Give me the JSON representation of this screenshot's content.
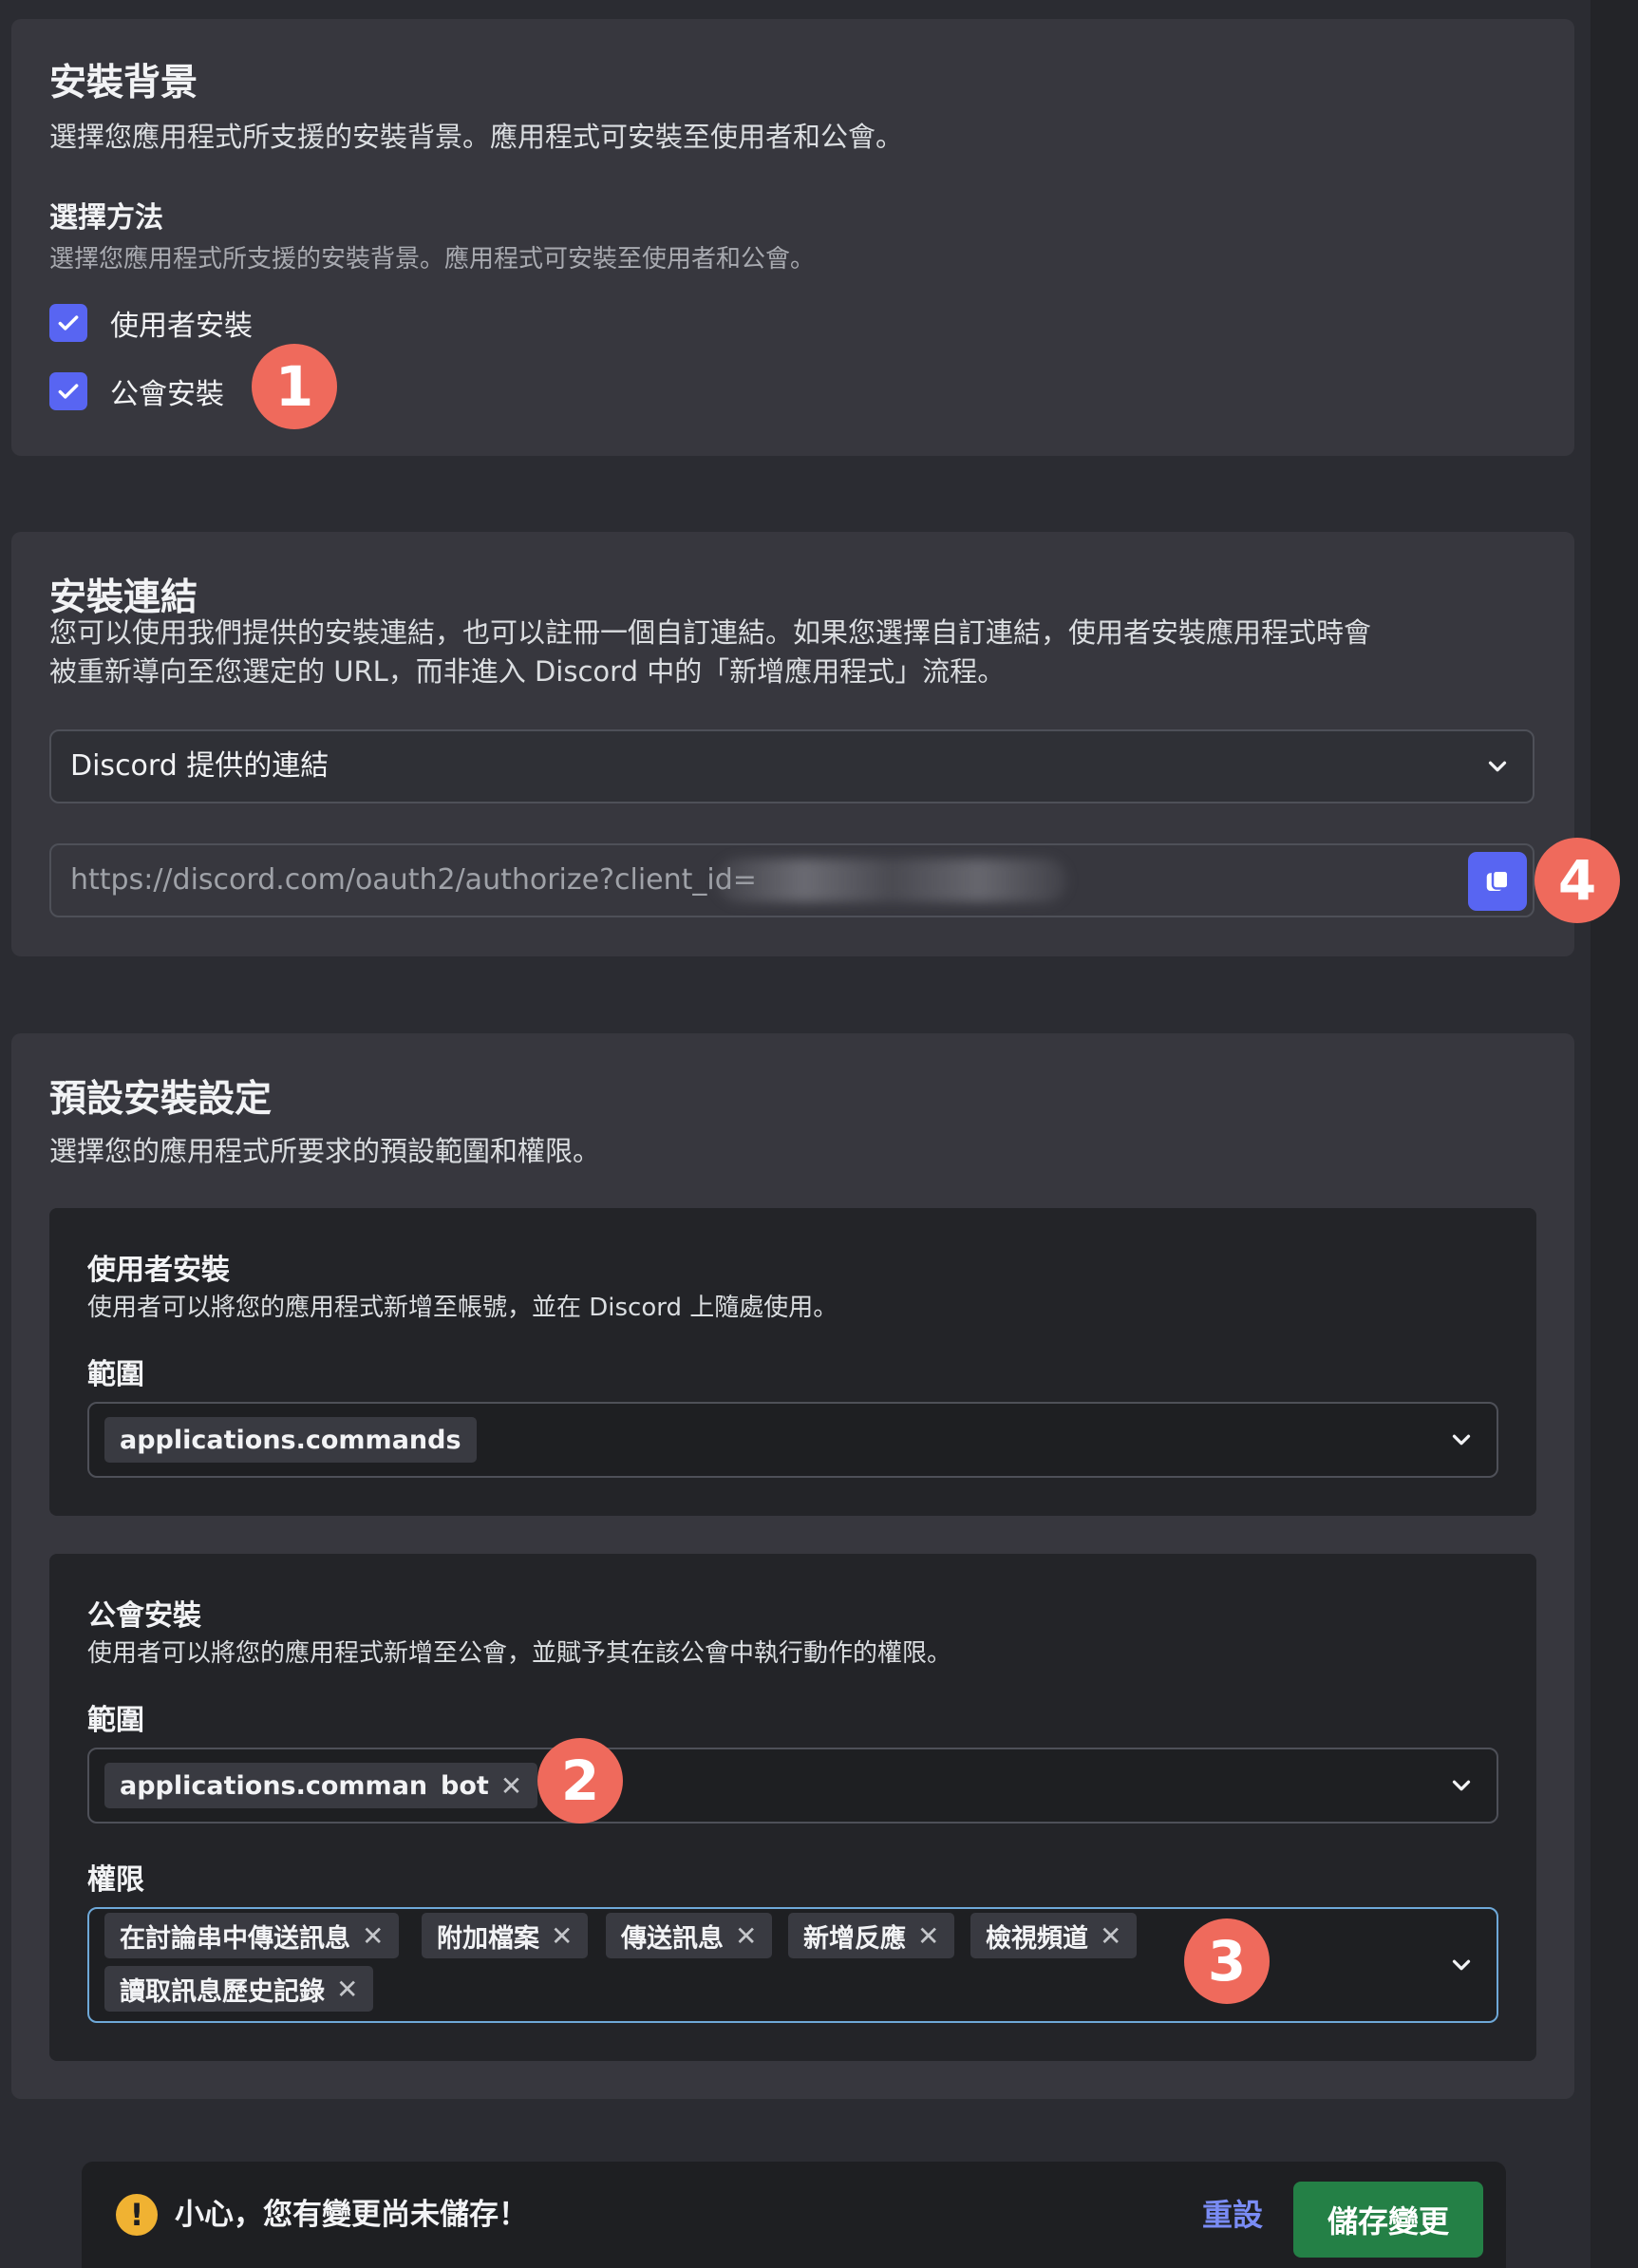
{
  "install_contexts": {
    "title": "安裝背景",
    "description": "選擇您應用程式所支援的安裝背景。應用程式可安裝至使用者和公會。",
    "method_title": "選擇方法",
    "method_description": "選擇您應用程式所支援的安裝背景。應用程式可安裝至使用者和公會。",
    "options": [
      {
        "label": "使用者安裝",
        "checked": true
      },
      {
        "label": "公會安裝",
        "checked": true
      }
    ]
  },
  "install_link": {
    "title": "安裝連結",
    "description_line1": "您可以使用我們提供的安裝連結，也可以註冊一個自訂連結。如果您選擇自訂連結，使用者安裝應用程式時會",
    "description_line2": "被重新導向至您選定的 URL，而非進入 Discord 中的「新增應用程式」流程。",
    "link_type": "Discord 提供的連結",
    "url": "https://discord.com/oauth2/authorize?client_id="
  },
  "default_install": {
    "title": "預設安裝設定",
    "description": "選擇您的應用程式所要求的預設範圍和權限。",
    "user_install": {
      "title": "使用者安裝",
      "description": "使用者可以將您的應用程式新增至帳號，並在 Discord 上隨處使用。",
      "scopes_label": "範圍",
      "scopes": [
        "applications.commands"
      ]
    },
    "guild_install": {
      "title": "公會安裝",
      "description": "使用者可以將您的應用程式新增至公會，並賦予其在該公會中執行動作的權限。",
      "scopes_label": "範圍",
      "scopes": [
        "applications.commands",
        "bot"
      ],
      "permissions_label": "權限",
      "permissions": [
        "在討論串中傳送訊息",
        "附加檔案",
        "傳送訊息",
        "新增反應",
        "檢視頻道",
        "讀取訊息歷史記錄"
      ]
    }
  },
  "annotations": [
    "1",
    "2",
    "3",
    "4"
  ],
  "save_bar": {
    "warning": "小心，您有變更尚未儲存！",
    "reset_label": "重設",
    "save_label": "儲存變更"
  },
  "colors": {
    "accent": "#5865f2",
    "save_green": "#248046",
    "badge": "#ef6a5c",
    "warning": "#f0b232"
  }
}
